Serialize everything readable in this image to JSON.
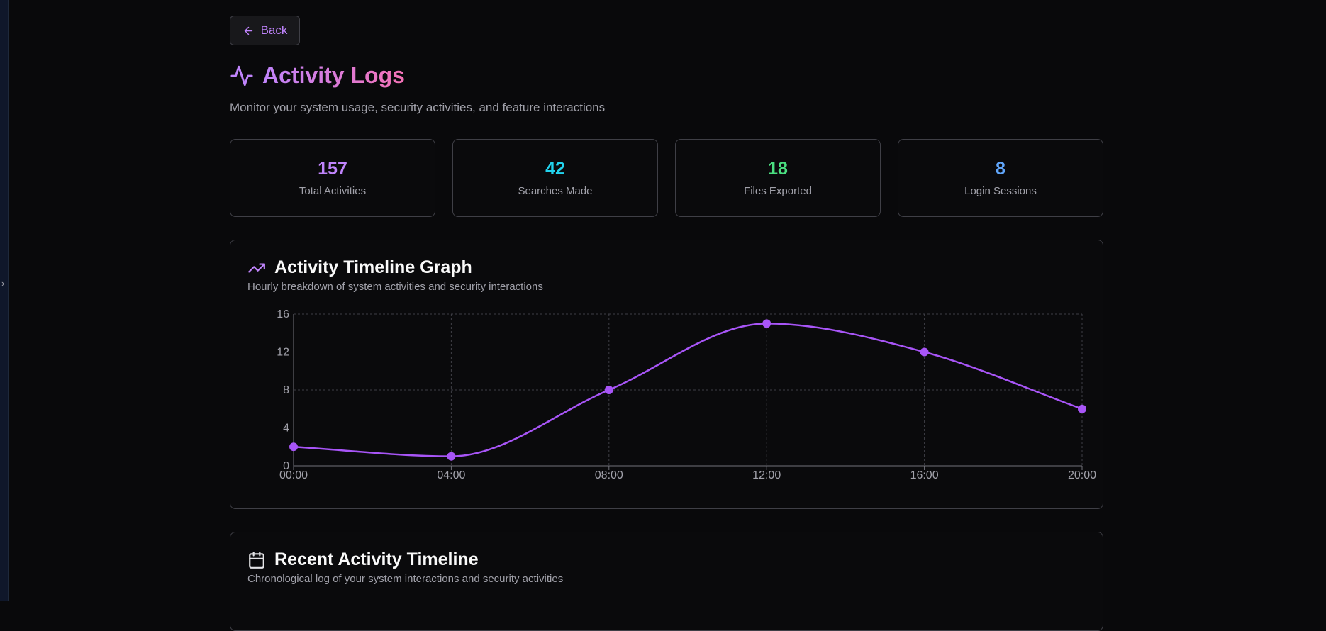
{
  "nav": {
    "back_label": "Back"
  },
  "header": {
    "title": "Activity Logs",
    "subtitle": "Monitor your system usage, security activities, and feature interactions"
  },
  "stats": [
    {
      "value": "157",
      "label": "Total Activities",
      "color": "#c084fc"
    },
    {
      "value": "42",
      "label": "Searches Made",
      "color": "#22d3ee"
    },
    {
      "value": "18",
      "label": "Files Exported",
      "color": "#4ade80"
    },
    {
      "value": "8",
      "label": "Login Sessions",
      "color": "#60a5fa"
    }
  ],
  "graph_card": {
    "title": "Activity Timeline Graph",
    "description": "Hourly breakdown of system activities and security interactions"
  },
  "recent_card": {
    "title": "Recent Activity Timeline",
    "description": "Chronological log of your system interactions and security activities"
  },
  "colors": {
    "accent": "#a855f7",
    "brand_gradient": [
      "#c084fc",
      "#f472b6"
    ]
  },
  "chart_data": {
    "type": "line",
    "categories": [
      "00:00",
      "04:00",
      "08:00",
      "12:00",
      "16:00",
      "20:00"
    ],
    "values": [
      2,
      1,
      8,
      15,
      12,
      6
    ],
    "ylim": [
      0,
      16
    ],
    "yticks": [
      "0",
      "4",
      "8",
      "12",
      "16"
    ],
    "grid": true,
    "line_color": "#a855f7"
  }
}
